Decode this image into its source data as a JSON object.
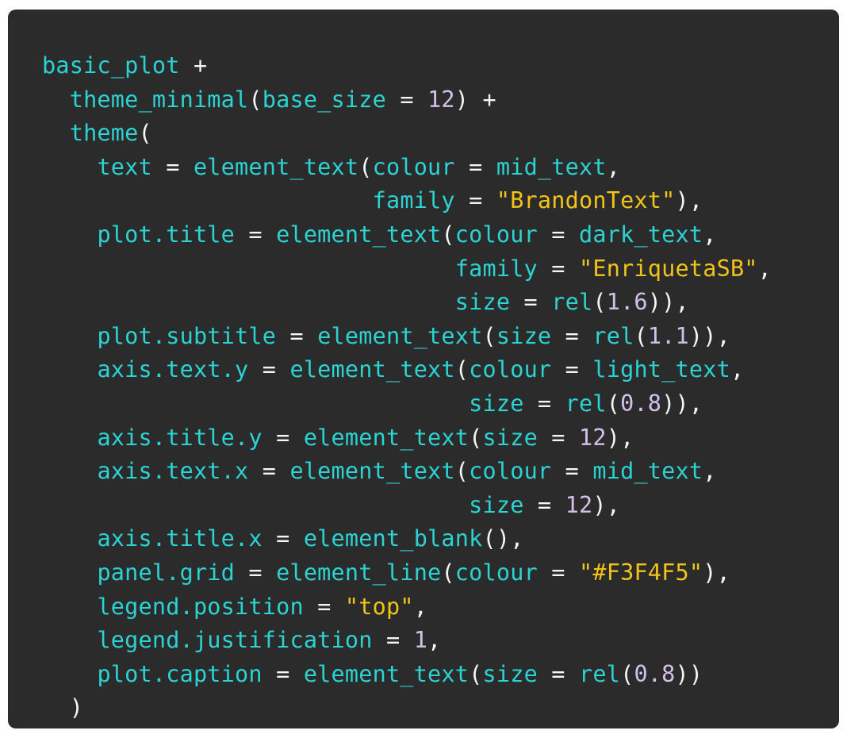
{
  "colors": {
    "background": "#2b2b2b",
    "identifier": "#2bd3d3",
    "string": "#f2c419",
    "number": "#d4c1ea",
    "operator": "#f5f5f5"
  },
  "code_lines": [
    [
      {
        "t": "id",
        "v": "basic_plot"
      },
      {
        "t": "op",
        "v": " +"
      }
    ],
    [
      {
        "t": "op",
        "v": "  "
      },
      {
        "t": "id",
        "v": "theme_minimal"
      },
      {
        "t": "op",
        "v": "("
      },
      {
        "t": "id",
        "v": "base_size"
      },
      {
        "t": "op",
        "v": " = "
      },
      {
        "t": "num",
        "v": "12"
      },
      {
        "t": "op",
        "v": ") +"
      }
    ],
    [
      {
        "t": "op",
        "v": "  "
      },
      {
        "t": "id",
        "v": "theme"
      },
      {
        "t": "op",
        "v": "("
      }
    ],
    [
      {
        "t": "op",
        "v": "    "
      },
      {
        "t": "id",
        "v": "text"
      },
      {
        "t": "op",
        "v": " = "
      },
      {
        "t": "id",
        "v": "element_text"
      },
      {
        "t": "op",
        "v": "("
      },
      {
        "t": "id",
        "v": "colour"
      },
      {
        "t": "op",
        "v": " = "
      },
      {
        "t": "id",
        "v": "mid_text"
      },
      {
        "t": "op",
        "v": ","
      }
    ],
    [
      {
        "t": "op",
        "v": "                        "
      },
      {
        "t": "id",
        "v": "family"
      },
      {
        "t": "op",
        "v": " = "
      },
      {
        "t": "str",
        "v": "\"BrandonText\""
      },
      {
        "t": "op",
        "v": "),"
      }
    ],
    [
      {
        "t": "op",
        "v": "    "
      },
      {
        "t": "id",
        "v": "plot.title"
      },
      {
        "t": "op",
        "v": " = "
      },
      {
        "t": "id",
        "v": "element_text"
      },
      {
        "t": "op",
        "v": "("
      },
      {
        "t": "id",
        "v": "colour"
      },
      {
        "t": "op",
        "v": " = "
      },
      {
        "t": "id",
        "v": "dark_text"
      },
      {
        "t": "op",
        "v": ","
      }
    ],
    [
      {
        "t": "op",
        "v": "                              "
      },
      {
        "t": "id",
        "v": "family"
      },
      {
        "t": "op",
        "v": " = "
      },
      {
        "t": "str",
        "v": "\"EnriquetaSB\""
      },
      {
        "t": "op",
        "v": ","
      }
    ],
    [
      {
        "t": "op",
        "v": "                              "
      },
      {
        "t": "id",
        "v": "size"
      },
      {
        "t": "op",
        "v": " = "
      },
      {
        "t": "id",
        "v": "rel"
      },
      {
        "t": "op",
        "v": "("
      },
      {
        "t": "num",
        "v": "1.6"
      },
      {
        "t": "op",
        "v": ")),"
      }
    ],
    [
      {
        "t": "op",
        "v": "    "
      },
      {
        "t": "id",
        "v": "plot.subtitle"
      },
      {
        "t": "op",
        "v": " = "
      },
      {
        "t": "id",
        "v": "element_text"
      },
      {
        "t": "op",
        "v": "("
      },
      {
        "t": "id",
        "v": "size"
      },
      {
        "t": "op",
        "v": " = "
      },
      {
        "t": "id",
        "v": "rel"
      },
      {
        "t": "op",
        "v": "("
      },
      {
        "t": "num",
        "v": "1.1"
      },
      {
        "t": "op",
        "v": ")),"
      }
    ],
    [
      {
        "t": "op",
        "v": "    "
      },
      {
        "t": "id",
        "v": "axis.text.y"
      },
      {
        "t": "op",
        "v": " = "
      },
      {
        "t": "id",
        "v": "element_text"
      },
      {
        "t": "op",
        "v": "("
      },
      {
        "t": "id",
        "v": "colour"
      },
      {
        "t": "op",
        "v": " = "
      },
      {
        "t": "id",
        "v": "light_text"
      },
      {
        "t": "op",
        "v": ","
      }
    ],
    [
      {
        "t": "op",
        "v": "                               "
      },
      {
        "t": "id",
        "v": "size"
      },
      {
        "t": "op",
        "v": " = "
      },
      {
        "t": "id",
        "v": "rel"
      },
      {
        "t": "op",
        "v": "("
      },
      {
        "t": "num",
        "v": "0.8"
      },
      {
        "t": "op",
        "v": ")),"
      }
    ],
    [
      {
        "t": "op",
        "v": "    "
      },
      {
        "t": "id",
        "v": "axis.title.y"
      },
      {
        "t": "op",
        "v": " = "
      },
      {
        "t": "id",
        "v": "element_text"
      },
      {
        "t": "op",
        "v": "("
      },
      {
        "t": "id",
        "v": "size"
      },
      {
        "t": "op",
        "v": " = "
      },
      {
        "t": "num",
        "v": "12"
      },
      {
        "t": "op",
        "v": "),"
      }
    ],
    [
      {
        "t": "op",
        "v": "    "
      },
      {
        "t": "id",
        "v": "axis.text.x"
      },
      {
        "t": "op",
        "v": " = "
      },
      {
        "t": "id",
        "v": "element_text"
      },
      {
        "t": "op",
        "v": "("
      },
      {
        "t": "id",
        "v": "colour"
      },
      {
        "t": "op",
        "v": " = "
      },
      {
        "t": "id",
        "v": "mid_text"
      },
      {
        "t": "op",
        "v": ","
      }
    ],
    [
      {
        "t": "op",
        "v": "                               "
      },
      {
        "t": "id",
        "v": "size"
      },
      {
        "t": "op",
        "v": " = "
      },
      {
        "t": "num",
        "v": "12"
      },
      {
        "t": "op",
        "v": "),"
      }
    ],
    [
      {
        "t": "op",
        "v": "    "
      },
      {
        "t": "id",
        "v": "axis.title.x"
      },
      {
        "t": "op",
        "v": " = "
      },
      {
        "t": "id",
        "v": "element_blank"
      },
      {
        "t": "op",
        "v": "(),"
      }
    ],
    [
      {
        "t": "op",
        "v": "    "
      },
      {
        "t": "id",
        "v": "panel.grid"
      },
      {
        "t": "op",
        "v": " = "
      },
      {
        "t": "id",
        "v": "element_line"
      },
      {
        "t": "op",
        "v": "("
      },
      {
        "t": "id",
        "v": "colour"
      },
      {
        "t": "op",
        "v": " = "
      },
      {
        "t": "str",
        "v": "\"#F3F4F5\""
      },
      {
        "t": "op",
        "v": "),"
      }
    ],
    [
      {
        "t": "op",
        "v": "    "
      },
      {
        "t": "id",
        "v": "legend.position"
      },
      {
        "t": "op",
        "v": " = "
      },
      {
        "t": "str",
        "v": "\"top\""
      },
      {
        "t": "op",
        "v": ","
      }
    ],
    [
      {
        "t": "op",
        "v": "    "
      },
      {
        "t": "id",
        "v": "legend.justification"
      },
      {
        "t": "op",
        "v": " = "
      },
      {
        "t": "num",
        "v": "1"
      },
      {
        "t": "op",
        "v": ","
      }
    ],
    [
      {
        "t": "op",
        "v": "    "
      },
      {
        "t": "id",
        "v": "plot.caption"
      },
      {
        "t": "op",
        "v": " = "
      },
      {
        "t": "id",
        "v": "element_text"
      },
      {
        "t": "op",
        "v": "("
      },
      {
        "t": "id",
        "v": "size"
      },
      {
        "t": "op",
        "v": " = "
      },
      {
        "t": "id",
        "v": "rel"
      },
      {
        "t": "op",
        "v": "("
      },
      {
        "t": "num",
        "v": "0.8"
      },
      {
        "t": "op",
        "v": "))"
      }
    ],
    [
      {
        "t": "op",
        "v": "  )"
      }
    ]
  ]
}
